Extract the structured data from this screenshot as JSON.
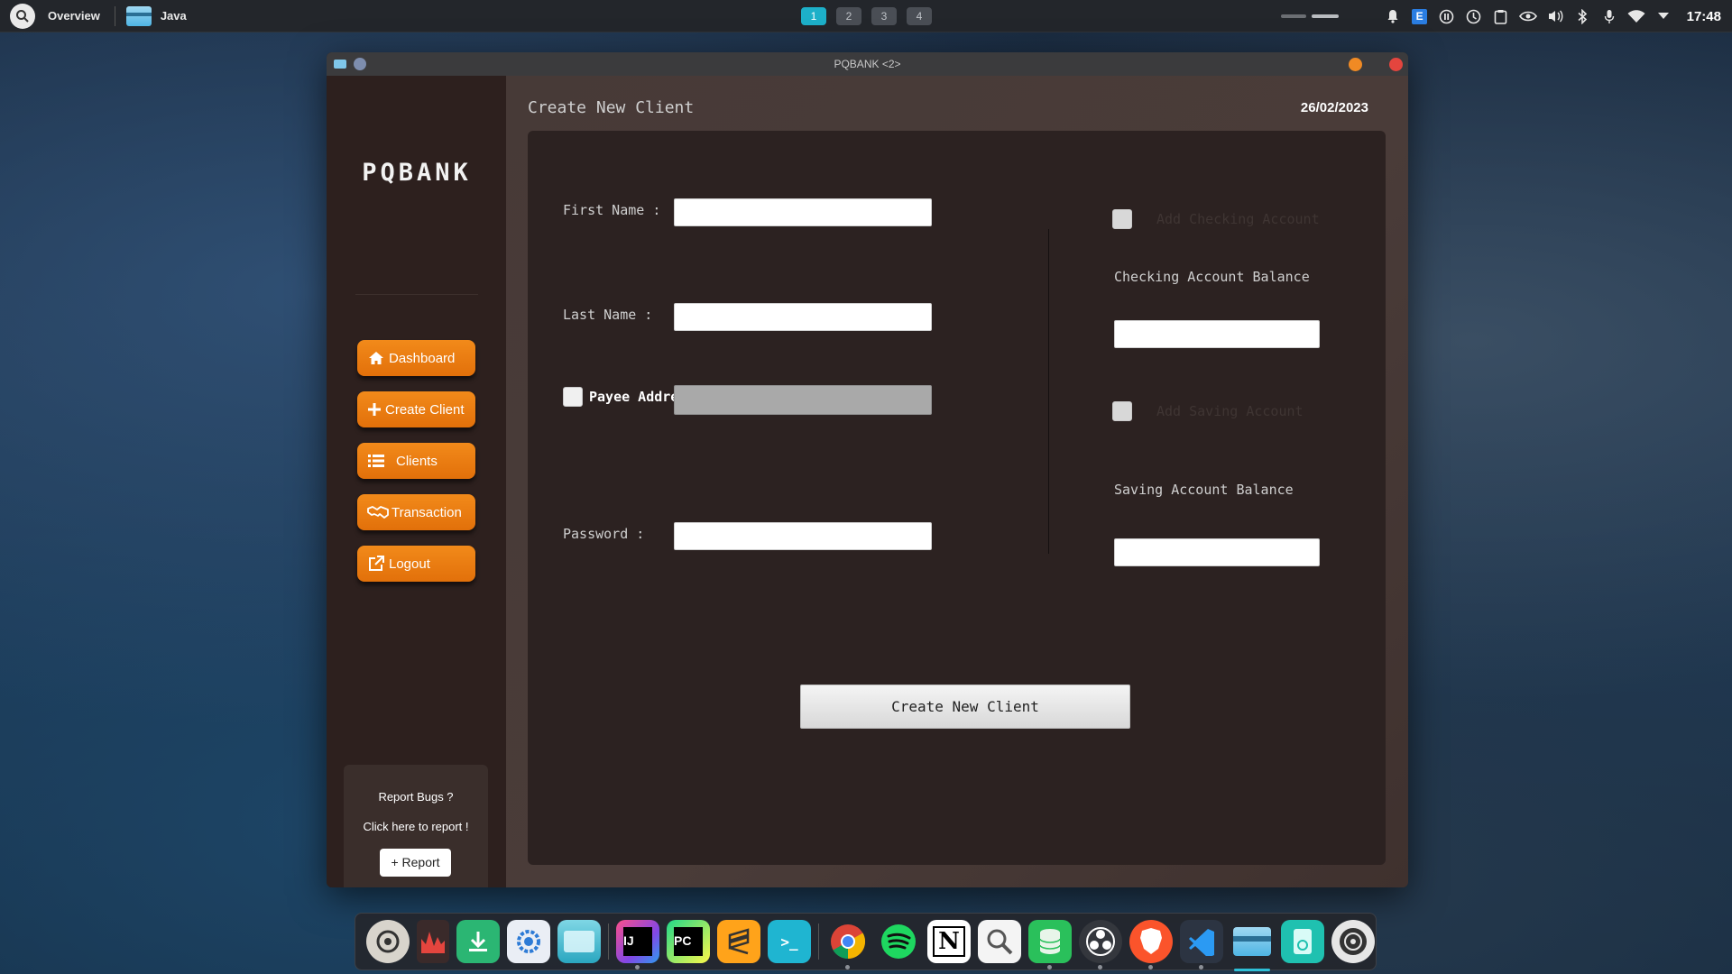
{
  "topbar": {
    "overview_label": "Overview",
    "app_name": "Java",
    "workspaces": [
      "1",
      "2",
      "3",
      "4"
    ],
    "active_workspace": "1",
    "clock": "17:48",
    "tray_icons": [
      "bell-icon",
      "e-badge-icon",
      "pause-icon",
      "timer-icon",
      "clipboard-icon",
      "nvidia-icon",
      "volume-icon",
      "bluetooth-icon",
      "microphone-icon",
      "wifi-icon",
      "dropdown-arrow-icon"
    ]
  },
  "window": {
    "title": "PQBANK <2>"
  },
  "sidebar": {
    "logo": "PQBANK",
    "nav": [
      {
        "label": "Dashboard",
        "icon": "home-icon"
      },
      {
        "label": "Create Client",
        "icon": "plus-icon"
      },
      {
        "label": "Clients",
        "icon": "list-icon"
      },
      {
        "label": "Transaction",
        "icon": "handshake-icon"
      },
      {
        "label": "Logout",
        "icon": "external-link-icon"
      }
    ],
    "report": {
      "question": "Report Bugs ?",
      "cta": "Click here to report !",
      "button": "+ Report"
    }
  },
  "main": {
    "title": "Create New Client",
    "date": "26/02/2023",
    "form": {
      "first_name_label": "First Name :",
      "first_name_value": "",
      "last_name_label": "Last Name :",
      "last_name_value": "",
      "payee_address_label": "Payee Address",
      "payee_address_value": "",
      "password_label": "Password :",
      "password_value": "",
      "add_checking_label": "Add Checking Account",
      "checking_balance_label": "Checking Account Balance",
      "checking_balance_value": "",
      "add_saving_label": "Add Saving Account",
      "saving_balance_label": "Saving Account Balance",
      "saving_balance_value": "",
      "submit_label": "Create New Client"
    }
  },
  "dock": {
    "apps": [
      "ubuntu-settings-icon",
      "system-monitor-icon",
      "downloader-icon",
      "settings-icon",
      "files-icon",
      "intellij-icon",
      "pycharm-icon",
      "sublime-icon",
      "terminal-icon",
      "chrome-icon",
      "spotify-icon",
      "notion-icon",
      "search-app-icon",
      "database-icon",
      "obs-icon",
      "brave-icon",
      "vscode-icon",
      "java-app-icon",
      "usb-icon",
      "disk-icon"
    ]
  },
  "colors": {
    "accent_orange": "#f28a1a",
    "workspace_active": "#1db0c9",
    "close_red": "#e4453e",
    "minimize_orange": "#f08a24"
  }
}
